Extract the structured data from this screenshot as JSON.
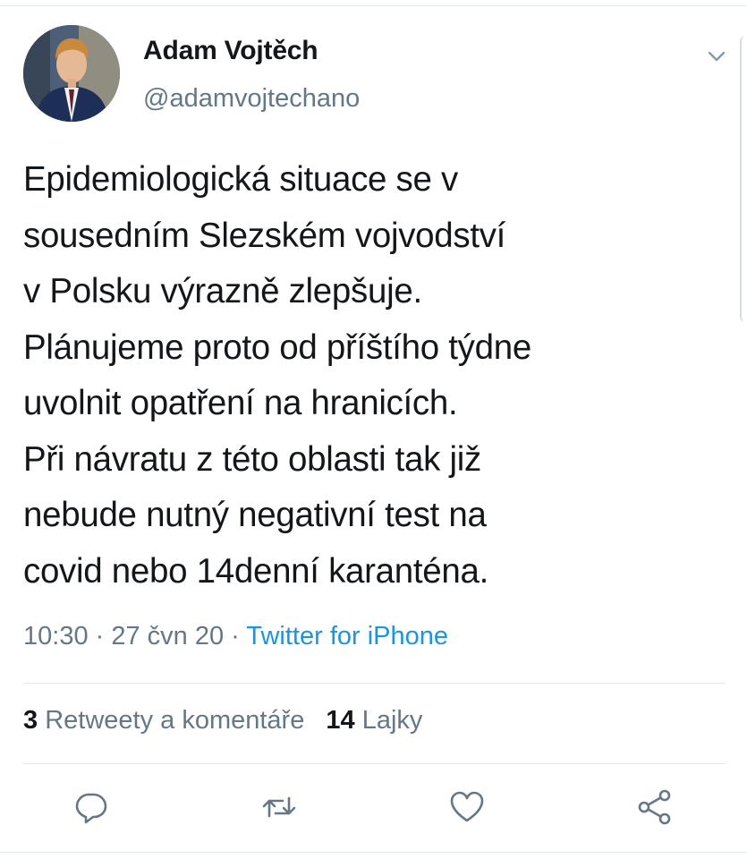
{
  "author": {
    "name": "Adam Vojtěch",
    "handle": "@adamvojtechano",
    "avatar": "avatar"
  },
  "tweet": {
    "text": "Epidemiologická situace se v\nsousedním Slezském vojvodství\nv Polsku výrazně zlepšuje.\nPlánujeme proto od příštího týdne\nuvolnit opatření na hranicích.\nPři návratu z této oblasti tak již\nnebude nutný negativní test na\ncovid nebo 14denní karanténa."
  },
  "meta": {
    "time": "10:30",
    "separator": " · ",
    "date": "27 čvn 20",
    "source": "Twitter for iPhone"
  },
  "stats": {
    "retweets_count": "3",
    "retweets_label": "Retweety a komentáře",
    "likes_count": "14",
    "likes_label": "Lajky"
  },
  "icons": {
    "menu": "chevron-down-icon",
    "reply": "reply-icon",
    "retweet": "retweet-icon",
    "like": "heart-icon",
    "share": "share-icon"
  },
  "colors": {
    "text": "#14171a",
    "secondary": "#657786",
    "link": "#1b95e0",
    "divider": "#e1e8ed"
  }
}
